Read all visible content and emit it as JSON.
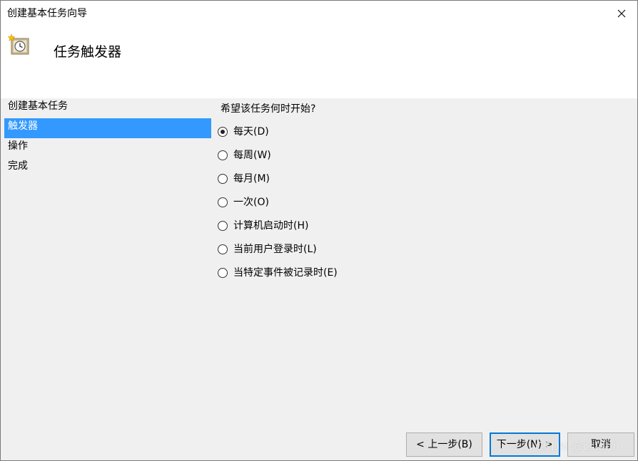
{
  "window": {
    "title": "创建基本任务向导"
  },
  "header": {
    "title": "任务触发器",
    "icon": "task-scheduler-clock-icon"
  },
  "nav": {
    "items": [
      {
        "label": "创建基本任务",
        "selected": false
      },
      {
        "label": "触发器",
        "selected": true
      },
      {
        "label": "操作",
        "selected": false
      },
      {
        "label": "完成",
        "selected": false
      }
    ]
  },
  "content": {
    "question": "希望该任务何时开始?",
    "options": [
      {
        "label": "每天(D)",
        "checked": true
      },
      {
        "label": "每周(W)",
        "checked": false
      },
      {
        "label": "每月(M)",
        "checked": false
      },
      {
        "label": "一次(O)",
        "checked": false
      },
      {
        "label": "计算机启动时(H)",
        "checked": false
      },
      {
        "label": "当前用户登录时(L)",
        "checked": false
      },
      {
        "label": "当特定事件被记录时(E)",
        "checked": false
      }
    ]
  },
  "buttons": {
    "back": "< 上一步(B)",
    "next": "下一步(N) >",
    "cancel": "取消"
  },
  "watermark": "CSDN @cslehh",
  "colors": {
    "selection": "#3399ff",
    "default_button_border": "#0078d7",
    "panel_background": "#f0f0f0"
  }
}
